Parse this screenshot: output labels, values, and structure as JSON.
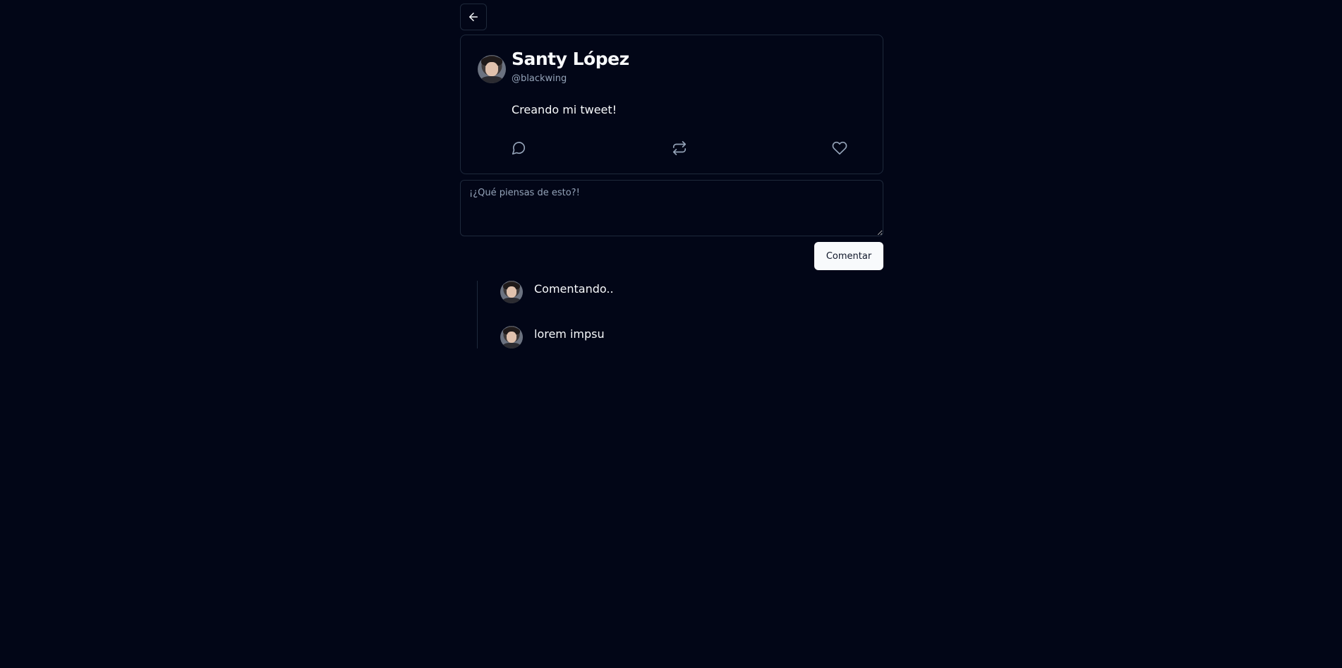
{
  "back_icon": "arrow-left-icon",
  "tweet": {
    "author_name": "Santy López",
    "author_handle": "@blackwing",
    "content": "Creando mi tweet!",
    "actions": {
      "comment_icon": "comment-icon",
      "retweet_icon": "retweet-icon",
      "like_icon": "heart-icon"
    }
  },
  "comment_form": {
    "placeholder": "¡¿Qué piensas de esto?!",
    "submit_label": "Comentar"
  },
  "comments": [
    {
      "text": "Comentando.."
    },
    {
      "text": "lorem impsu"
    }
  ],
  "colors": {
    "background": "#020617",
    "border": "#1e293b",
    "text": "#f8fafc",
    "muted": "#94a3b8",
    "button_bg": "#f8fafc"
  }
}
